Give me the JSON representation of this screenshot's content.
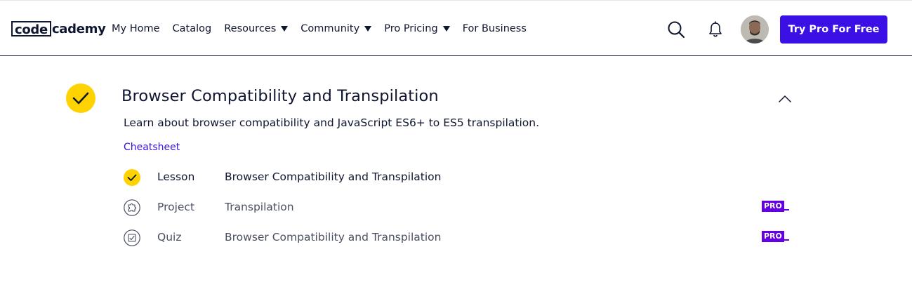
{
  "header": {
    "logo": {
      "box_text": "code",
      "rest_text": "cademy"
    },
    "nav": [
      {
        "label": "My Home",
        "dropdown": false
      },
      {
        "label": "Catalog",
        "dropdown": false
      },
      {
        "label": "Resources",
        "dropdown": true
      },
      {
        "label": "Community",
        "dropdown": true
      },
      {
        "label": "Pro Pricing",
        "dropdown": true
      },
      {
        "label": "For Business",
        "dropdown": false
      }
    ],
    "icons": {
      "search": "search-icon",
      "notifications": "bell-icon"
    },
    "cta_label": "Try Pro For Free"
  },
  "module": {
    "title": "Browser Compatibility and Transpilation",
    "description": "Learn about browser compatibility and JavaScript ES6+ to ES5 transpilation.",
    "cheatsheet_label": "Cheatsheet",
    "completed": true,
    "items": [
      {
        "type": "Lesson",
        "name": "Browser Compatibility and Transpilation",
        "icon": "check-icon",
        "pro": ""
      },
      {
        "type": "Project",
        "name": "Transpilation",
        "icon": "puzzle-icon",
        "pro": "PRO"
      },
      {
        "type": "Quiz",
        "name": "Browser Compatibility and Transpilation",
        "icon": "quiz-icon",
        "pro": "PRO"
      }
    ]
  },
  "colors": {
    "brand": "#3a10e5",
    "check": "#ffd300",
    "pro_badge": "#6400e4",
    "text": "#10162f"
  }
}
